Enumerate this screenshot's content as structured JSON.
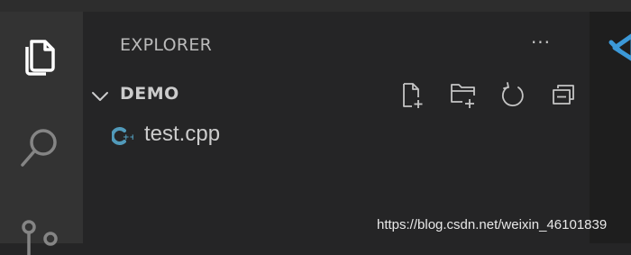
{
  "sidebar": {
    "title": "EXPLORER",
    "more_actions": "···",
    "folder": {
      "name": "DEMO",
      "actions": [
        {
          "icon": "new-file-icon"
        },
        {
          "icon": "new-folder-icon"
        },
        {
          "icon": "refresh-icon"
        },
        {
          "icon": "collapse-all-icon"
        }
      ]
    },
    "files": [
      {
        "name": "test.cpp",
        "icon": "cpp-file-icon"
      }
    ]
  },
  "activity_bar": {
    "items": [
      {
        "icon": "explorer-files-icon"
      },
      {
        "icon": "search-icon"
      },
      {
        "icon": "source-control-icon"
      }
    ]
  },
  "watermark": "https://blog.csdn.net/weixin_46101839",
  "colors": {
    "activity_bar_bg": "#333333",
    "sidebar_bg": "#252526",
    "editor_bg": "#1e1e1e",
    "accent": "#3c99d8",
    "cpp_icon": "#519aba"
  }
}
